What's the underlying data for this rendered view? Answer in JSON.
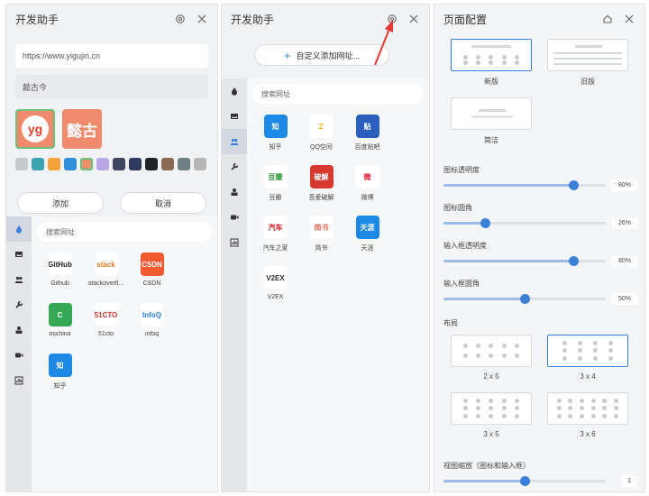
{
  "panel1": {
    "title": "开发助手",
    "url_value": "https://www.yigujin.cn",
    "name_value": "懿古今",
    "logo_a_text": "yg",
    "logo_b_text": "懿古",
    "swatches": [
      "#c8cacd",
      "#3aa5b0",
      "#f2a43a",
      "#2f8fdb",
      "#f0906c",
      "#b7a6e6",
      "#3e4560",
      "#2c3b5e",
      "#202225",
      "#8a6a55",
      "#6f7f86",
      "#b5b5b5"
    ],
    "add_label": "添加",
    "cancel_label": "取消",
    "search_placeholder": "搜索网址",
    "sites": [
      {
        "label": "Github",
        "tile": "GitHub",
        "color": "#ffffff",
        "fg": "#222"
      },
      {
        "label": "stackoverfl...",
        "tile": "stack",
        "color": "#ffffff",
        "fg": "#e87922"
      },
      {
        "label": "CSDN",
        "tile": "CSDN",
        "color": "#f05a30",
        "fg": "#ffffff"
      },
      {
        "label": "oschina",
        "tile": "C",
        "color": "#34a853",
        "fg": "#ffffff"
      },
      {
        "label": "51cto",
        "tile": "51CTO",
        "color": "#ffffff",
        "fg": "#d63a2f"
      },
      {
        "label": "infoq",
        "tile": "InfoQ",
        "color": "#ffffff",
        "fg": "#2c7be5"
      },
      {
        "label": "知乎",
        "tile": "知",
        "color": "#1e88e5",
        "fg": "#ffffff"
      }
    ]
  },
  "panel2": {
    "title": "开发助手",
    "add_custom_label": "自定义添加网址...",
    "search_placeholder": "搜索网址",
    "sites": [
      {
        "label": "知乎",
        "tile": "知",
        "color": "#1e88e5",
        "fg": "#ffffff"
      },
      {
        "label": "QQ空间",
        "tile": "Z",
        "color": "#ffffff",
        "fg": "#f5b800"
      },
      {
        "label": "百度贴吧",
        "tile": "贴",
        "color": "#2a5fbd",
        "fg": "#ffffff"
      },
      {
        "label": "豆瓣",
        "tile": "豆瓣",
        "color": "#ffffff",
        "fg": "#2e963d"
      },
      {
        "label": "吾爱破解",
        "tile": "破解",
        "color": "#d63a2f",
        "fg": "#ffffff"
      },
      {
        "label": "微博",
        "tile": "微",
        "color": "#ffffff",
        "fg": "#e6162d"
      },
      {
        "label": "汽车之家",
        "tile": "汽车",
        "color": "#ffffff",
        "fg": "#c7161d"
      },
      {
        "label": "简书",
        "tile": "简书",
        "color": "#ffffff",
        "fg": "#e9705a"
      },
      {
        "label": "天涯",
        "tile": "天涯",
        "color": "#1e88e5",
        "fg": "#ffffff"
      },
      {
        "label": "V2EX",
        "tile": "V2EX",
        "color": "#ffffff",
        "fg": "#333333"
      }
    ]
  },
  "panel3": {
    "title": "页面配置",
    "style_new": "新版",
    "style_old": "旧版",
    "style_simple": "简洁",
    "icon_opacity_label": "图标透明度",
    "icon_opacity_value": "80%",
    "icon_opacity": 0.8,
    "icon_radius_label": "图标圆角",
    "icon_radius_value": "26%",
    "icon_radius": 0.26,
    "input_opacity_label": "输入框透明度",
    "input_opacity_value": "80%",
    "input_opacity": 0.8,
    "input_radius_label": "输入框圆角",
    "input_radius_value": "50%",
    "input_radius": 0.5,
    "layout_label": "布局",
    "layouts": [
      "2 x 5",
      "3 x 4",
      "3 x 5",
      "3 x 6"
    ],
    "zoom_label": "视图缩放（图标和输入框）",
    "zoom_value": "1",
    "zoom": 0.5
  },
  "accent": "#3b7fd9",
  "arrow_color": "#e53935"
}
